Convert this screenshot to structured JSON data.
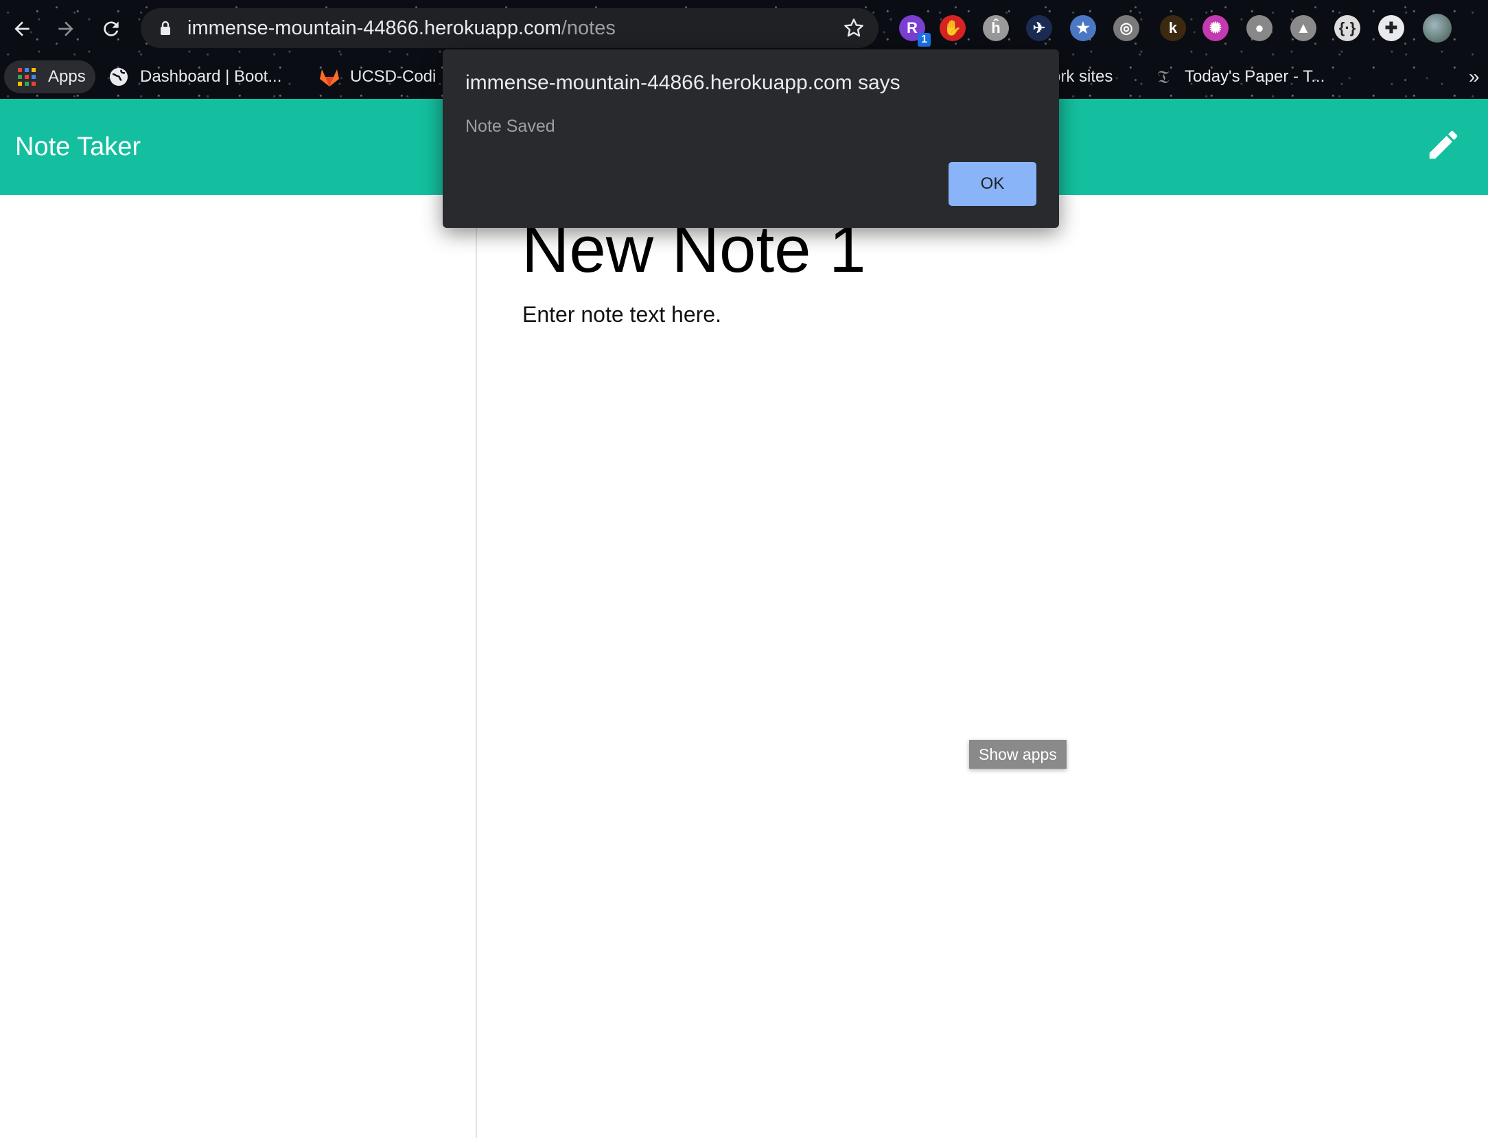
{
  "browser": {
    "url_host": "immense-mountain-44866.herokuapp.com",
    "url_path": "/notes",
    "extensions": [
      {
        "name": "extension-r-icon",
        "label": "R",
        "badge": "1",
        "color": "#7b3fd1"
      },
      {
        "name": "stop-hand-icon",
        "label": "✋",
        "color": "#d62424"
      },
      {
        "name": "extension-h-icon",
        "label": "ĥ",
        "color": "#9a9a9a"
      },
      {
        "name": "plane-icon",
        "label": "✈",
        "color": "#1b2b53"
      },
      {
        "name": "star-badge-icon",
        "label": "★",
        "color": "#4a78c2"
      },
      {
        "name": "brain-icon",
        "label": "◎",
        "color": "#7a7a7a"
      },
      {
        "name": "extension-k-icon",
        "label": "k",
        "color": "#3b2a10"
      },
      {
        "name": "color-wheel-icon",
        "label": "✺",
        "color": "#c43ab0"
      },
      {
        "name": "acorn-icon",
        "label": "●",
        "color": "#888888"
      },
      {
        "name": "drive-icon",
        "label": "▲",
        "color": "#8a8a8a"
      },
      {
        "name": "json-icon",
        "label": "{·}",
        "color": "#dddddd"
      },
      {
        "name": "puzzle-icon",
        "label": "✚",
        "color": "#e8eaed"
      }
    ]
  },
  "bookmarks": {
    "apps": "Apps",
    "items": [
      {
        "label": "Dashboard | Boot..."
      },
      {
        "label": "UCSD-Codi"
      },
      {
        "label": "ork sites"
      },
      {
        "label": "Today's Paper - T..."
      }
    ],
    "overflow": "»"
  },
  "app": {
    "brand": "Note Taker",
    "note_title": "New Note 1",
    "note_text": "Enter note text here.",
    "show_apps": "Show apps"
  },
  "dialog": {
    "title": "immense-mountain-44866.herokuapp.com says",
    "message": "Note Saved",
    "ok_label": "OK"
  },
  "colors": {
    "header": "#14bf9f",
    "ok_button": "#8ab4f8",
    "dialog_bg": "#292a2d"
  }
}
